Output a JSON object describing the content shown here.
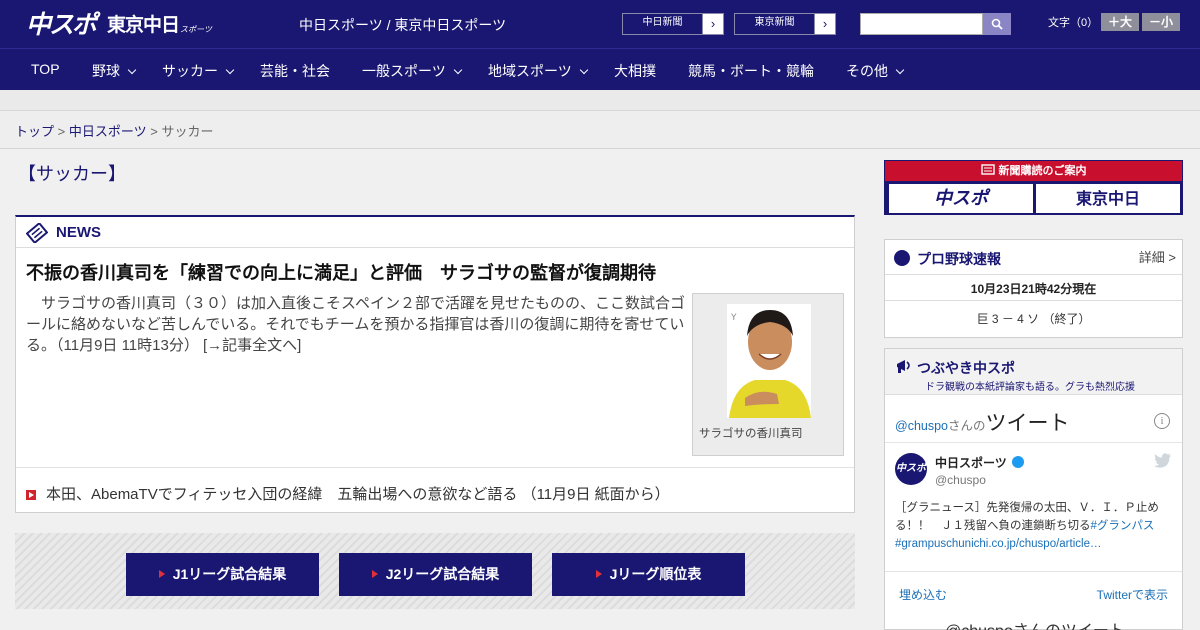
{
  "header": {
    "logo_main": "中スポ",
    "logo_sub": "東京中日",
    "logo_sub_small": "スポーツ",
    "site_name": "中日スポーツ / 東京中日スポーツ",
    "paper_buttons": [
      {
        "label": "中日新聞",
        "arrow": "›"
      },
      {
        "label": "東京新聞",
        "arrow": "›"
      }
    ],
    "search": {
      "placeholder": ""
    },
    "font_size_label": "文字（0）",
    "font_plus": "＋大",
    "font_minus": "－小"
  },
  "nav": {
    "items": [
      {
        "label": "TOP",
        "dropdown": false
      },
      {
        "label": "野球",
        "dropdown": true
      },
      {
        "label": "サッカー",
        "dropdown": true
      },
      {
        "label": "芸能・社会",
        "dropdown": false
      },
      {
        "label": "一般スポーツ",
        "dropdown": true
      },
      {
        "label": "地域スポーツ",
        "dropdown": true
      },
      {
        "label": "大相撲",
        "dropdown": false
      },
      {
        "label": "競馬・ボート・競輪",
        "dropdown": false
      },
      {
        "label": "その他",
        "dropdown": true
      }
    ]
  },
  "breadcrumb": {
    "items": [
      "トップ",
      "中日スポーツ",
      "サッカー"
    ],
    "separator": ">"
  },
  "page": {
    "title": "【サッカー】"
  },
  "news": {
    "label": "NEWS",
    "headline": "不振の香川真司を「練習での向上に満足」と評価　サラゴサの監督が復調期待",
    "body": "　サラゴサの香川真司（３０）は加入直後こそスペイン２部で活躍を見せたものの、ここ数試合ゴールに絡めないなど苦しんでいる。それでもチームを預かる指揮官は香川の復調に期待を寄せている。（11月9日 11時13分）",
    "more_link": "[→記事全文へ]",
    "photo_caption": "サラゴサの香川真司",
    "related": "本田、AbemaTVでフィテッセ入団の経緯　五輪出場への意欲など語る （11月9日 紙面から）"
  },
  "league_buttons": [
    "J1リーグ試合結果",
    "J2リーグ試合結果",
    "Jリーグ順位表"
  ],
  "sidebar": {
    "subscription": {
      "title": "新聞購読のご案内",
      "btn1": "中スポ",
      "btn2": "東京中日"
    },
    "baseball": {
      "title": "プロ野球速報",
      "detail": "詳細 >",
      "time": "10月23日21時42分現在",
      "score": "巨 3 － 4 ソ （終了）"
    },
    "tweets": {
      "title": "つぶやき中スポ",
      "subtitle": "ドラ観戦の本紙評論家も語る。グラも熱烈応援",
      "embed_handle": "@chuspo",
      "embed_san": "さんの",
      "embed_tweet": "ツイート",
      "info": "i",
      "user_name": "中日スポーツ",
      "user_handle": "@chuspo",
      "avatar_text": "中スポ",
      "text": "［グラニュース］先発復帰の太田、Ｖ．Ｉ．Ｐ止める！！　Ｊ１残留へ負の連鎖断ち切る",
      "hashtag": "#グランパス",
      "link": "#grampuschunichi.co.jp/chuspo/article…",
      "embed_link": "埋め込む",
      "view_link": "Twitterで表示",
      "bottom_text": "@chuspoさんのツイート"
    }
  },
  "colors": {
    "brand": "#1a1772",
    "accent_red": "#d0232e",
    "link_blue": "#1b6fb7"
  }
}
